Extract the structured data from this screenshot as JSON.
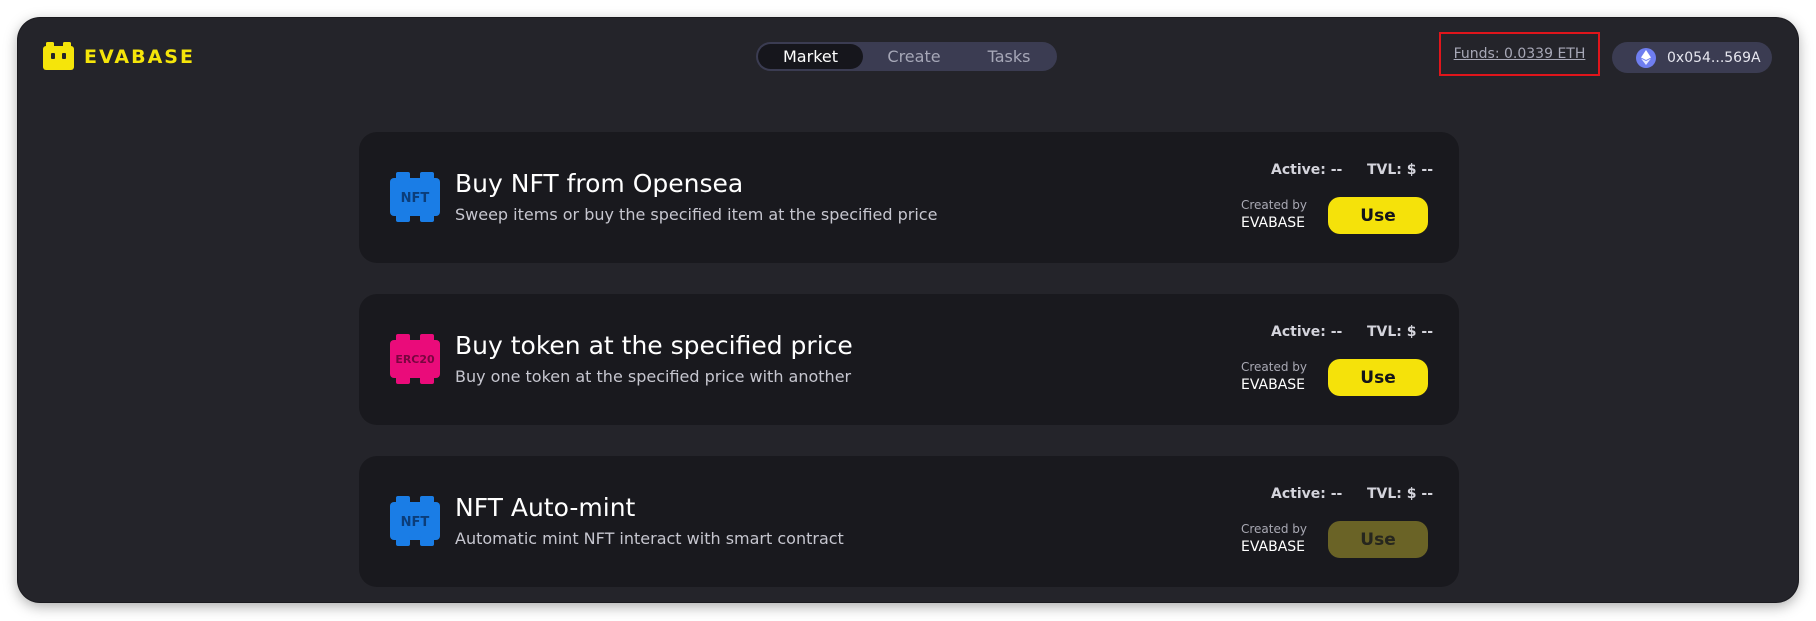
{
  "header": {
    "logo_text": "EVABASE",
    "nav_tabs": [
      {
        "label": "Market",
        "active": true
      },
      {
        "label": "Create",
        "active": false
      },
      {
        "label": "Tasks",
        "active": false
      }
    ],
    "funds": "Funds: 0.0339 ETH",
    "wallet_address": "0x054...569A",
    "wallet_icon": "ethereum-icon"
  },
  "cards": [
    {
      "icon_label": "NFT",
      "icon_color": "#1a7de6",
      "title": "Buy NFT from Opensea",
      "description": "Sweep items or buy the specified item at the specified price",
      "active": "Active: --",
      "tvl": "TVL: $ --",
      "created_label": "Created by",
      "created_by": "EVABASE",
      "button": "Use"
    },
    {
      "icon_label": "ERC20",
      "icon_color": "#ea0b7a",
      "title": "Buy token at the specified price",
      "description": "Buy one token at the specified price with another",
      "active": "Active: --",
      "tvl": "TVL: $ --",
      "created_label": "Created by",
      "created_by": "EVABASE",
      "button": "Use"
    },
    {
      "icon_label": "NFT",
      "icon_color": "#1a7de6",
      "title": "NFT Auto-mint",
      "description": "Automatic mint NFT interact with smart contract",
      "active": "Active: --",
      "tvl": "TVL: $ --",
      "created_label": "Created by",
      "created_by": "EVABASE",
      "button": "Use"
    }
  ],
  "colors": {
    "accent": "#f5e20a",
    "background": "#24242a",
    "card": "#19191e",
    "highlight_border": "#e0151b"
  }
}
